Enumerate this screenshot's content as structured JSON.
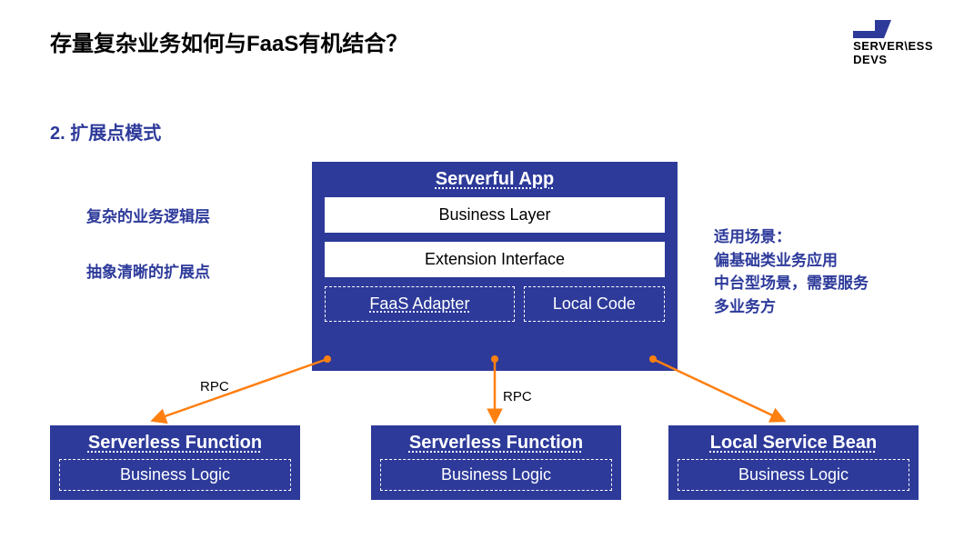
{
  "title": "存量复杂业务如何与FaaS有机结合？",
  "logo": {
    "line1": "SERVER\\ESS",
    "line2": "DEVS"
  },
  "subtitle": "2. 扩展点模式",
  "leftLabels": {
    "l1": "复杂的业务逻辑层",
    "l2": "抽象清晰的扩展点"
  },
  "rightLabels": {
    "heading": "适用场景：",
    "line1": "偏基础类业务应用",
    "line2": "中台型场景，需要服务",
    "line3": "多业务方"
  },
  "app": {
    "title": "Serverful App",
    "businessLayer": "Business Layer",
    "extensionInterface": "Extension Interface",
    "faasAdapter": "FaaS Adapter",
    "localCode": "Local Code"
  },
  "bottom": {
    "b1": {
      "title": "Serverless Function",
      "logic": "Business Logic"
    },
    "b2": {
      "title": "Serverless Function",
      "logic": "Business Logic"
    },
    "b3": {
      "title": "Local Service Bean",
      "logic": "Business Logic"
    }
  },
  "rpc": {
    "r1": "RPC",
    "r2": "RPC"
  },
  "colors": {
    "primary": "#2d3a9a",
    "arrow": "#ff7f11"
  }
}
